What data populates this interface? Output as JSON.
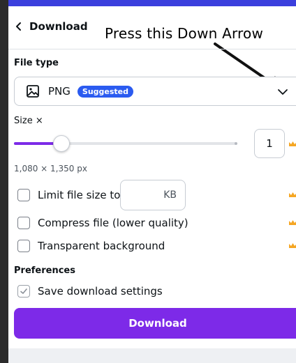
{
  "header": {
    "title": "Download",
    "annotation": "Press this Down Arrow"
  },
  "file_type": {
    "label": "File type",
    "selected": "PNG",
    "badge": "Suggested"
  },
  "size": {
    "label": "Size ×",
    "value": "1",
    "dimensions": "1,080 × 1,350 px"
  },
  "options": {
    "limit_file_size": {
      "label": "Limit file size to",
      "checked": false,
      "unit": "KB",
      "value": ""
    },
    "compress": {
      "label": "Compress file (lower quality)",
      "checked": false
    },
    "transparent": {
      "label": "Transparent background",
      "checked": false
    }
  },
  "preferences": {
    "label": "Preferences",
    "save_settings": {
      "label": "Save download settings",
      "checked": true
    }
  },
  "download_button": {
    "label": "Download"
  },
  "colors": {
    "accent": "#7d2ae8",
    "badge": "#2b5bf0",
    "crown": "#f5a623"
  }
}
